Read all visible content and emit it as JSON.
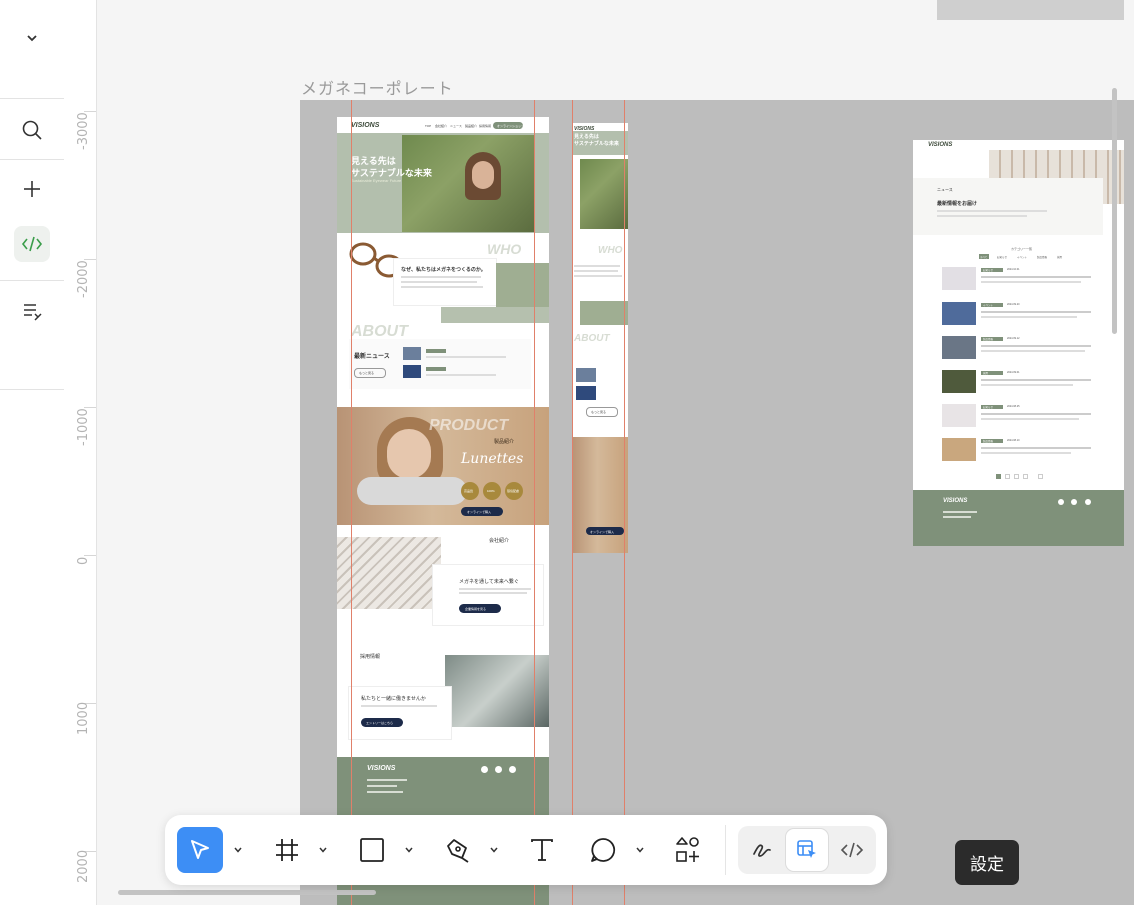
{
  "leftbar": {
    "collapse": "chevron-down",
    "search": "search",
    "add": "plus",
    "code": "code",
    "layers": "layers-list"
  },
  "ruler": {
    "labels": [
      "-3000",
      "-2000",
      "-1000",
      "0",
      "1000",
      "2000"
    ]
  },
  "canvas": {
    "frame_title": "メガネコーポレート"
  },
  "mock_desktop": {
    "logo": "VISIONS",
    "nav": [
      "TOP",
      "会社紹介",
      "ニュース",
      "製品紹介",
      "採用情報"
    ],
    "nav_cta": "オンラインショップ",
    "hero_line1": "見える先は",
    "hero_line2": "サステナブルな未来",
    "hero_sub": "Sustainable Eyewear Future",
    "who": "WHO",
    "about_heading": "なぜ、私たちはメガネをつくるのか。",
    "about": "ABOUT",
    "news_heading": "最新ニュース",
    "news_more": "もっと見る",
    "product": "PRODUCT",
    "product_label": "製品紹介",
    "product_script": "Lunettes",
    "badges": [
      "高品質",
      "100%",
      "環境配慮"
    ],
    "shop_button": "オンラインで購入",
    "company_label": "会社紹介",
    "company_heading": "メガネを通して未来へ繋ぐ",
    "company_button": "企業情報を見る",
    "recruit_label": "採用情報",
    "recruit_heading": "私たちと一緒に働きませんか",
    "recruit_button": "エントリーはこちら",
    "footer_logo": "VISIONS"
  },
  "mock_mobile": {
    "logo": "VISIONS",
    "hero_line1": "見える先は",
    "hero_line2": "サステナブルな未来",
    "who": "WHO",
    "about": "ABOUT",
    "more": "もっと見る",
    "shop_button": "オンラインで購入"
  },
  "mock_news": {
    "logo": "VISIONS",
    "page_label": "ニュース",
    "heading": "最新情報をお届け",
    "categories_title": "カテゴリー一覧",
    "tabs": [
      "すべて",
      "お知らせ",
      "イベント",
      "製品情報",
      "採用"
    ],
    "items": [
      {
        "tag": "お知らせ",
        "date": "2024.10.01"
      },
      {
        "tag": "イベント",
        "date": "2024.09.20"
      },
      {
        "tag": "製品情報",
        "date": "2024.09.12"
      },
      {
        "tag": "採用",
        "date": "2024.09.01"
      },
      {
        "tag": "お知らせ",
        "date": "2024.08.25"
      },
      {
        "tag": "製品情報",
        "date": "2024.08.10"
      }
    ],
    "footer_logo": "VISIONS"
  },
  "toolbar": {
    "move": "move-tool",
    "frame": "frame-tool",
    "shape": "rectangle-tool",
    "pen": "pen-tool",
    "text": "text-tool",
    "comment": "comment-tool",
    "actions": "actions-tool"
  },
  "tooltip": {
    "label": "設定"
  },
  "colors": {
    "accent_green": "#3a9d4a",
    "select_blue": "#3d8ef5",
    "brand_green": "#7f917a",
    "navy": "#1d2b4a",
    "tan": "#c7a27c"
  }
}
